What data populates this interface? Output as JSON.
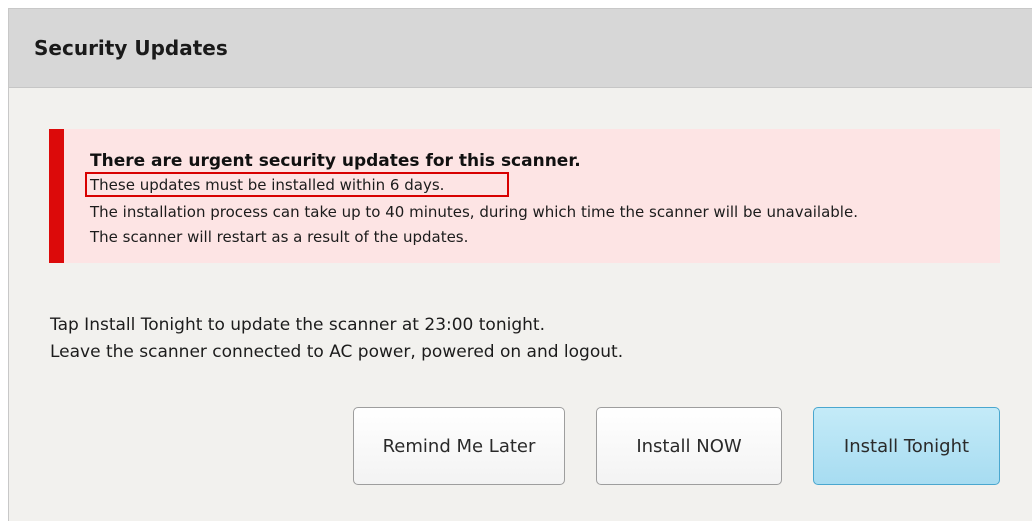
{
  "dialog": {
    "title": "Security Updates"
  },
  "alert": {
    "title": "There are urgent security updates for this scanner.",
    "lines": [
      "These updates must be installed within 6 days.",
      "The installation process can take up to 40 minutes, during which time the scanner will be unavailable.",
      "The scanner will restart as a result of the updates."
    ],
    "accent_color": "#dc0a0a",
    "background_color": "#fde4e4"
  },
  "instructions": {
    "line1": "Tap Install Tonight to update the scanner at 23:00 tonight.",
    "line2": "Leave the scanner connected to AC power, powered on and logout."
  },
  "buttons": {
    "remind_later": "Remind Me Later",
    "install_now": "Install NOW",
    "install_tonight": "Install Tonight"
  },
  "colors": {
    "primary_button": "#a7dcf1",
    "header": "#d7d7d7"
  }
}
